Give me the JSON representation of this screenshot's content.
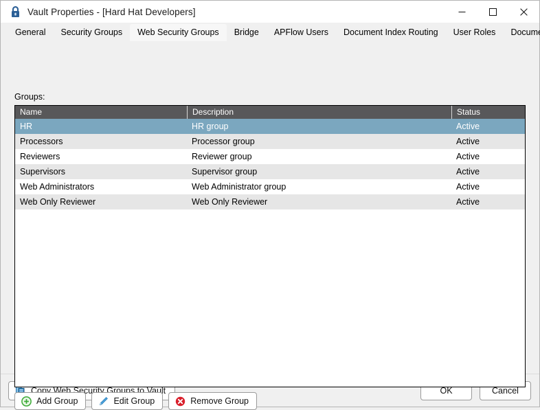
{
  "window": {
    "title": "Vault Properties - [Hard Hat Developers]",
    "icon": "lock-icon",
    "controls": {
      "minimize": "minimize-icon",
      "maximize": "maximize-icon",
      "close": "close-icon"
    }
  },
  "tabs": [
    {
      "label": "General",
      "active": false
    },
    {
      "label": "Security Groups",
      "active": false
    },
    {
      "label": "Web Security Groups",
      "active": true
    },
    {
      "label": "Bridge",
      "active": false
    },
    {
      "label": "APFlow Users",
      "active": false
    },
    {
      "label": "Document Index Routing",
      "active": false
    },
    {
      "label": "User Roles",
      "active": false
    },
    {
      "label": "Document Publishing",
      "active": false
    }
  ],
  "main": {
    "groups_label": "Groups:",
    "columns": [
      "Name",
      "Description",
      "Status"
    ],
    "rows": [
      {
        "name": "HR",
        "description": "HR group",
        "status": "Active",
        "selected": true
      },
      {
        "name": "Processors",
        "description": "Processor group",
        "status": "Active",
        "selected": false
      },
      {
        "name": "Reviewers",
        "description": "Reviewer group",
        "status": "Active",
        "selected": false
      },
      {
        "name": "Supervisors",
        "description": "Supervisor group",
        "status": "Active",
        "selected": false
      },
      {
        "name": "Web Administrators",
        "description": "Web Administrator group",
        "status": "Active",
        "selected": false
      },
      {
        "name": "Web Only Reviewer",
        "description": "Web Only Reviewer",
        "status": "Active",
        "selected": false
      }
    ]
  },
  "actions": {
    "add_group": "Add Group",
    "edit_group": "Edit Group",
    "remove_group": "Remove Group"
  },
  "footer": {
    "copy_groups": "Copy Web Security Groups to Vault",
    "ok": "OK",
    "cancel": "Cancel"
  },
  "colors": {
    "header_bg": "#58585a",
    "selected_row": "#7ba7bf",
    "alt_row": "#e6e6e6",
    "window_bg": "#f0f0f0",
    "add_icon": "#3aaa35",
    "edit_icon": "#4aa3df",
    "remove_icon": "#d91f2b",
    "copy_icon": "#1f6fa8",
    "lock_icon": "#2b5f96"
  }
}
